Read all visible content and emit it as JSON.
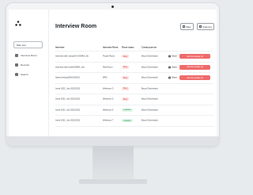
{
  "sidebar": {
    "plan_tour": "Plan tour",
    "items": [
      {
        "label": "Interview Room",
        "icon": "grid-icon"
      },
      {
        "label": "Recruits",
        "icon": "users-icon"
      },
      {
        "label": "Search",
        "icon": "search-icon"
      }
    ]
  },
  "header": {
    "title": "Interview Room",
    "filter_label": "Filter",
    "columns_label": "Columns"
  },
  "table": {
    "columns": [
      "Interview",
      "Interview Room",
      "Room status",
      "Contact person"
    ],
    "rows": [
      {
        "interview": "Interview with Joseph/CV/SMAN_Str",
        "room": "Purple Room",
        "status": "Busy",
        "status_type": "busy",
        "contact": "Bruce Dünenbach",
        "share": "Share",
        "alert": "Alert the people (4)"
      },
      {
        "interview": "Interview with Isobel/SDEN_Jari",
        "room": "Red Room",
        "status": "Busy",
        "status_type": "busy",
        "contact": "Bruce Dünenbach",
        "share": "Share",
        "alert": "Alert the people (4)"
      },
      {
        "interview": "Speed testing/SINUS/2022",
        "room": "BRO",
        "status": "Busy",
        "status_type": "busy",
        "contact": "Bruce Dünenbach",
        "share": "Share",
        "alert": "Alert the people (4)"
      },
      {
        "interview": "Invite 2022, Jan 2022/2022",
        "room": "Webroom 3",
        "status": "Busy",
        "status_type": "busy",
        "contact": "Bruce Dünenbach"
      },
      {
        "interview": "Invite 2022, Jan 2022/2022",
        "room": "Webroom 5",
        "status": "Busy",
        "status_type": "busy",
        "contact": "Bruce Dünenbach"
      },
      {
        "interview": "Invite 2022, Jan 2022/2022",
        "room": "Webroom 6",
        "status": "Available",
        "status_type": "available",
        "contact": "Bruce Dünenbach"
      },
      {
        "interview": "Invite 2022, Jan 2022/2022",
        "room": "Webroom 7",
        "status": "Available",
        "status_type": "available",
        "contact": "Bruce Dünenbach"
      }
    ]
  },
  "colors": {
    "alert": "#ef6b6b",
    "busy_text": "#d23c3c",
    "available_text": "#2c9a52"
  }
}
